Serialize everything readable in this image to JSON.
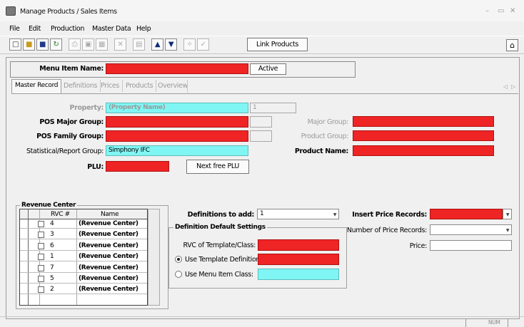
{
  "window": {
    "title": "Manage Products / Sales Items",
    "min": "–",
    "max": "▭",
    "close": "✕"
  },
  "menu": [
    "File",
    "Edit",
    "Production",
    "Master Data",
    "Help"
  ],
  "toolbar": {
    "link_products": "Link Products"
  },
  "header": {
    "menu_item_name_label": "Menu Item Name:",
    "active_button": "Active"
  },
  "tabs": [
    "Master Record",
    "Definitions",
    "Prices",
    "Products",
    "Overview"
  ],
  "tab_nav": {
    "prev": "◁",
    "next": "▷"
  },
  "fields": {
    "property_label": "Property:",
    "property_value": "(Property Name)",
    "property_num": "1",
    "pos_major_label": "POS Major Group:",
    "pos_family_label": "POS Family Group:",
    "stat_label": "Statistical/Report Group:",
    "stat_value": "Simphony IFC",
    "plu_label": "PLU:",
    "next_plu": "Next free PLU",
    "major_group_label": "Major Group:",
    "product_group_label": "Product Group:",
    "product_name_label": "Product Name:"
  },
  "revenue_center": {
    "title": "Revenue Center",
    "col_rvc": "RVC #",
    "col_name": "Name",
    "rows": [
      {
        "rvc": "4",
        "name": "(Revenue Center)"
      },
      {
        "rvc": "3",
        "name": "(Revenue Center)"
      },
      {
        "rvc": "6",
        "name": "(Revenue Center)"
      },
      {
        "rvc": "1",
        "name": "(Revenue Center)"
      },
      {
        "rvc": "7",
        "name": "(Revenue Center)"
      },
      {
        "rvc": "5",
        "name": "(Revenue Center)"
      },
      {
        "rvc": "2",
        "name": "(Revenue Center)"
      }
    ]
  },
  "definitions": {
    "to_add_label": "Definitions to add:",
    "to_add_value": "1",
    "group_title": "Definition Default Settings",
    "rvc_template_label": "RVC of Template/Class:",
    "use_template_label": "Use Template Definition:",
    "use_class_label": "Use Menu Item Class:"
  },
  "prices": {
    "insert_label": "Insert Price Records:",
    "number_label": "Number of Price Records:",
    "price_label": "Price:"
  },
  "status": {
    "num": "NUM"
  },
  "colors": {
    "required": "#ef2424",
    "readonly": "#80f6f4"
  }
}
